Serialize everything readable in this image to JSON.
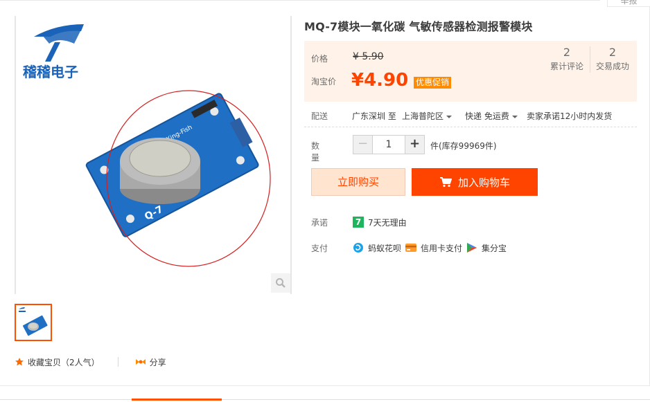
{
  "report_label": "举报",
  "brand": {
    "logo_text": "稽稽电子"
  },
  "product": {
    "title": "MQ-7模块一氧化碳    气敏传感器检测报警模块",
    "board_label": "Q-7",
    "board_brand": "Xing-Fish"
  },
  "price": {
    "label": "价格",
    "original": "¥ 5.90",
    "promo_label": "淘宝价",
    "promo_price": "¥4.90",
    "badge": "优惠促销"
  },
  "stats": [
    {
      "num": "2",
      "label": "累计评论"
    },
    {
      "num": "2",
      "label": "交易成功"
    }
  ],
  "shipping": {
    "label": "配送",
    "from": "广东深圳 至",
    "to": "上海普陀区",
    "method": "快递 免运费",
    "promise": "卖家承诺12小时内发货"
  },
  "quantity": {
    "label": "数量",
    "minus": "−",
    "value": "1",
    "plus": "+",
    "stock": "件(库存99969件)"
  },
  "buttons": {
    "buy": "立即购买",
    "cart": "加入购物车"
  },
  "promise": {
    "label": "承诺",
    "badge": "7",
    "text": "7天无理由"
  },
  "payment": {
    "label": "支付",
    "items": [
      {
        "icon": "huabei-icon",
        "text": "蚂蚁花呗"
      },
      {
        "icon": "credit-card-icon",
        "text": "信用卡支付"
      },
      {
        "icon": "jifenbao-icon",
        "text": "集分宝"
      }
    ]
  },
  "actions": {
    "favorite": "收藏宝贝（2人气）",
    "share": "分享"
  },
  "colors": {
    "accent": "#ff4400",
    "price_bg": "#fff2e8",
    "brand_blue": "#1a63b8"
  }
}
